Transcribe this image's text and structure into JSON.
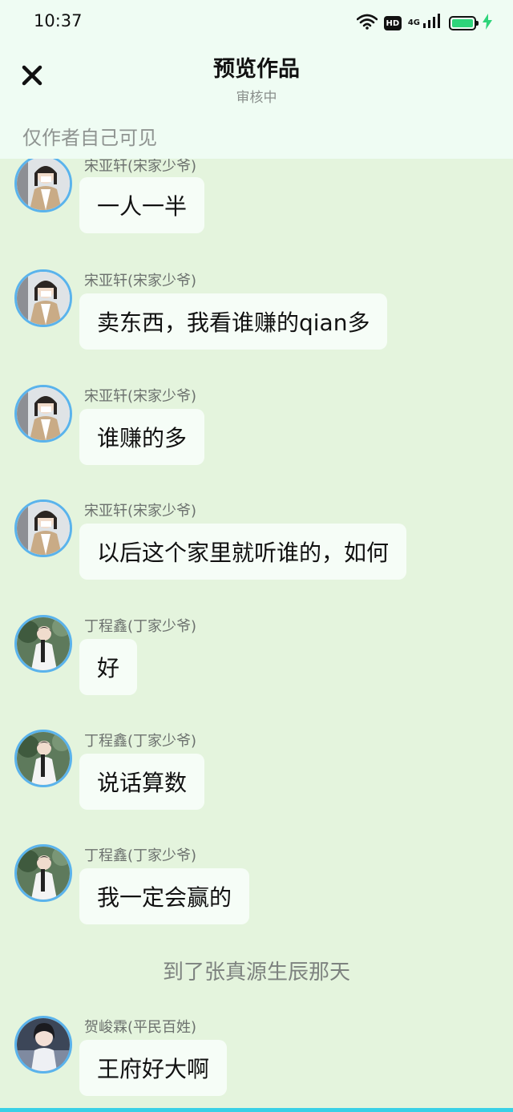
{
  "status_bar": {
    "time": "10:37",
    "hd_label": "HD",
    "network_label": "4G",
    "battery_level": 1.0,
    "icons": [
      "wifi-icon",
      "hd-icon",
      "cellular-4g-icon",
      "battery-charging-icon"
    ]
  },
  "header": {
    "close_icon": "close-icon",
    "title": "预览作品",
    "subtitle": "审核中",
    "visibility_note": "仅作者自己可见"
  },
  "colors": {
    "header_bg": "#effcf3",
    "chat_bg": "#e4f4dd",
    "bubble_bg": "#f6fdf7",
    "avatar_ring": "#5ab3ec",
    "bottom_accent": "#3ad0e6",
    "battery": "#2ed47a"
  },
  "messages": [
    {
      "name": "宋亚轩(宋家少爷)",
      "text": "一人一半",
      "avatar": "songyaxuan"
    },
    {
      "name": "宋亚轩(宋家少爷)",
      "text": "卖东西，我看谁赚的qian多",
      "avatar": "songyaxuan"
    },
    {
      "name": "宋亚轩(宋家少爷)",
      "text": "谁赚的多",
      "avatar": "songyaxuan"
    },
    {
      "name": "宋亚轩(宋家少爷)",
      "text": "以后这个家里就听谁的，如何",
      "avatar": "songyaxuan"
    },
    {
      "name": "丁程鑫(丁家少爷)",
      "text": "好",
      "avatar": "dingchengxin"
    },
    {
      "name": "丁程鑫(丁家少爷)",
      "text": "说话算数",
      "avatar": "dingchengxin"
    },
    {
      "name": "丁程鑫(丁家少爷)",
      "text": "我一定会赢的",
      "avatar": "dingchengxin"
    },
    {
      "name": "贺峻霖(平民百姓)",
      "text": "王府好大啊",
      "avatar": "hejunlin"
    }
  ],
  "narration": "到了张真源生辰那天"
}
